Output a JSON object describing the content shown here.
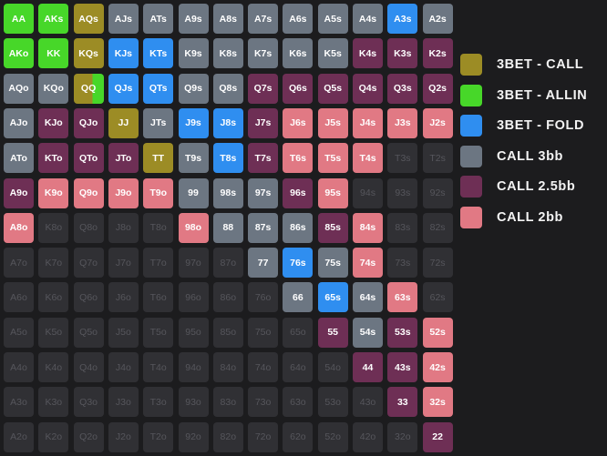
{
  "colors": {
    "3bet_call": "#9c8c25",
    "3bet_allin": "#47d729",
    "3bet_fold": "#2f8ef0",
    "call_3bb": "#6c7682",
    "call_2_5bb": "#6e2f55",
    "call_2bb": "#e17984",
    "fold": "#303034"
  },
  "legend": [
    {
      "key": "3bet_call",
      "label": "3BET - CALL"
    },
    {
      "key": "3bet_allin",
      "label": "3BET - ALLIN"
    },
    {
      "key": "3bet_fold",
      "label": "3BET - FOLD"
    },
    {
      "key": "call_3bb",
      "label": "CALL 3bb"
    },
    {
      "key": "call_2_5bb",
      "label": "CALL 2.5bb"
    },
    {
      "key": "call_2bb",
      "label": "CALL 2bb"
    }
  ],
  "grid": [
    [
      [
        "AA",
        "3bet_allin"
      ],
      [
        "AKs",
        "3bet_allin"
      ],
      [
        "AQs",
        "3bet_call"
      ],
      [
        "AJs",
        "call_3bb"
      ],
      [
        "ATs",
        "call_3bb"
      ],
      [
        "A9s",
        "call_3bb"
      ],
      [
        "A8s",
        "call_3bb"
      ],
      [
        "A7s",
        "call_3bb"
      ],
      [
        "A6s",
        "call_3bb"
      ],
      [
        "A5s",
        "call_3bb"
      ],
      [
        "A4s",
        "call_3bb"
      ],
      [
        "A3s",
        "3bet_fold"
      ],
      [
        "A2s",
        "call_3bb"
      ]
    ],
    [
      [
        "AKo",
        "3bet_allin"
      ],
      [
        "KK",
        "3bet_allin"
      ],
      [
        "KQs",
        "3bet_call"
      ],
      [
        "KJs",
        "3bet_fold"
      ],
      [
        "KTs",
        "3bet_fold"
      ],
      [
        "K9s",
        "call_3bb"
      ],
      [
        "K8s",
        "call_3bb"
      ],
      [
        "K7s",
        "call_3bb"
      ],
      [
        "K6s",
        "call_3bb"
      ],
      [
        "K5s",
        "call_3bb"
      ],
      [
        "K4s",
        "call_2_5bb"
      ],
      [
        "K3s",
        "call_2_5bb"
      ],
      [
        "K2s",
        "call_2_5bb"
      ]
    ],
    [
      [
        "AQo",
        "call_3bb"
      ],
      [
        "KQo",
        "call_3bb"
      ],
      [
        "QQ",
        "split_call_allin"
      ],
      [
        "QJs",
        "3bet_fold"
      ],
      [
        "QTs",
        "3bet_fold"
      ],
      [
        "Q9s",
        "call_3bb"
      ],
      [
        "Q8s",
        "call_3bb"
      ],
      [
        "Q7s",
        "call_2_5bb"
      ],
      [
        "Q6s",
        "call_2_5bb"
      ],
      [
        "Q5s",
        "call_2_5bb"
      ],
      [
        "Q4s",
        "call_2_5bb"
      ],
      [
        "Q3s",
        "call_2_5bb"
      ],
      [
        "Q2s",
        "call_2_5bb"
      ]
    ],
    [
      [
        "AJo",
        "call_3bb"
      ],
      [
        "KJo",
        "call_2_5bb"
      ],
      [
        "QJo",
        "call_2_5bb"
      ],
      [
        "JJ",
        "3bet_call"
      ],
      [
        "JTs",
        "call_3bb"
      ],
      [
        "J9s",
        "3bet_fold"
      ],
      [
        "J8s",
        "3bet_fold"
      ],
      [
        "J7s",
        "call_2_5bb"
      ],
      [
        "J6s",
        "call_2bb"
      ],
      [
        "J5s",
        "call_2bb"
      ],
      [
        "J4s",
        "call_2bb"
      ],
      [
        "J3s",
        "call_2bb"
      ],
      [
        "J2s",
        "call_2bb"
      ]
    ],
    [
      [
        "ATo",
        "call_3bb"
      ],
      [
        "KTo",
        "call_2_5bb"
      ],
      [
        "QTo",
        "call_2_5bb"
      ],
      [
        "JTo",
        "call_2_5bb"
      ],
      [
        "TT",
        "3bet_call"
      ],
      [
        "T9s",
        "call_3bb"
      ],
      [
        "T8s",
        "3bet_fold"
      ],
      [
        "T7s",
        "call_2_5bb"
      ],
      [
        "T6s",
        "call_2bb"
      ],
      [
        "T5s",
        "call_2bb"
      ],
      [
        "T4s",
        "call_2bb"
      ],
      [
        "T3s",
        "fold"
      ],
      [
        "T2s",
        "fold"
      ]
    ],
    [
      [
        "A9o",
        "call_2_5bb"
      ],
      [
        "K9o",
        "call_2bb"
      ],
      [
        "Q9o",
        "call_2bb"
      ],
      [
        "J9o",
        "call_2bb"
      ],
      [
        "T9o",
        "call_2bb"
      ],
      [
        "99",
        "call_3bb"
      ],
      [
        "98s",
        "call_3bb"
      ],
      [
        "97s",
        "call_3bb"
      ],
      [
        "96s",
        "call_2_5bb"
      ],
      [
        "95s",
        "call_2bb"
      ],
      [
        "94s",
        "fold"
      ],
      [
        "93s",
        "fold"
      ],
      [
        "92s",
        "fold"
      ]
    ],
    [
      [
        "A8o",
        "call_2bb"
      ],
      [
        "K8o",
        "fold"
      ],
      [
        "Q8o",
        "fold"
      ],
      [
        "J8o",
        "fold"
      ],
      [
        "T8o",
        "fold"
      ],
      [
        "98o",
        "call_2bb"
      ],
      [
        "88",
        "call_3bb"
      ],
      [
        "87s",
        "call_3bb"
      ],
      [
        "86s",
        "call_3bb"
      ],
      [
        "85s",
        "call_2_5bb"
      ],
      [
        "84s",
        "call_2bb"
      ],
      [
        "83s",
        "fold"
      ],
      [
        "82s",
        "fold"
      ]
    ],
    [
      [
        "A7o",
        "fold"
      ],
      [
        "K7o",
        "fold"
      ],
      [
        "Q7o",
        "fold"
      ],
      [
        "J7o",
        "fold"
      ],
      [
        "T7o",
        "fold"
      ],
      [
        "97o",
        "fold"
      ],
      [
        "87o",
        "fold"
      ],
      [
        "77",
        "call_3bb"
      ],
      [
        "76s",
        "3bet_fold"
      ],
      [
        "75s",
        "call_3bb"
      ],
      [
        "74s",
        "call_2bb"
      ],
      [
        "73s",
        "fold"
      ],
      [
        "72s",
        "fold"
      ]
    ],
    [
      [
        "A6o",
        "fold"
      ],
      [
        "K6o",
        "fold"
      ],
      [
        "Q6o",
        "fold"
      ],
      [
        "J6o",
        "fold"
      ],
      [
        "T6o",
        "fold"
      ],
      [
        "96o",
        "fold"
      ],
      [
        "86o",
        "fold"
      ],
      [
        "76o",
        "fold"
      ],
      [
        "66",
        "call_3bb"
      ],
      [
        "65s",
        "3bet_fold"
      ],
      [
        "64s",
        "call_3bb"
      ],
      [
        "63s",
        "call_2bb"
      ],
      [
        "62s",
        "fold"
      ]
    ],
    [
      [
        "A5o",
        "fold"
      ],
      [
        "K5o",
        "fold"
      ],
      [
        "Q5o",
        "fold"
      ],
      [
        "J5o",
        "fold"
      ],
      [
        "T5o",
        "fold"
      ],
      [
        "95o",
        "fold"
      ],
      [
        "85o",
        "fold"
      ],
      [
        "75o",
        "fold"
      ],
      [
        "65o",
        "fold"
      ],
      [
        "55",
        "call_2_5bb"
      ],
      [
        "54s",
        "call_3bb"
      ],
      [
        "53s",
        "call_2_5bb"
      ],
      [
        "52s",
        "call_2bb"
      ]
    ],
    [
      [
        "A4o",
        "fold"
      ],
      [
        "K4o",
        "fold"
      ],
      [
        "Q4o",
        "fold"
      ],
      [
        "J4o",
        "fold"
      ],
      [
        "T4o",
        "fold"
      ],
      [
        "94o",
        "fold"
      ],
      [
        "84o",
        "fold"
      ],
      [
        "74o",
        "fold"
      ],
      [
        "64o",
        "fold"
      ],
      [
        "54o",
        "fold"
      ],
      [
        "44",
        "call_2_5bb"
      ],
      [
        "43s",
        "call_2_5bb"
      ],
      [
        "42s",
        "call_2bb"
      ]
    ],
    [
      [
        "A3o",
        "fold"
      ],
      [
        "K3o",
        "fold"
      ],
      [
        "Q3o",
        "fold"
      ],
      [
        "J3o",
        "fold"
      ],
      [
        "T3o",
        "fold"
      ],
      [
        "93o",
        "fold"
      ],
      [
        "83o",
        "fold"
      ],
      [
        "73o",
        "fold"
      ],
      [
        "63o",
        "fold"
      ],
      [
        "53o",
        "fold"
      ],
      [
        "43o",
        "fold"
      ],
      [
        "33",
        "call_2_5bb"
      ],
      [
        "32s",
        "call_2bb"
      ]
    ],
    [
      [
        "A2o",
        "fold"
      ],
      [
        "K2o",
        "fold"
      ],
      [
        "Q2o",
        "fold"
      ],
      [
        "J2o",
        "fold"
      ],
      [
        "T2o",
        "fold"
      ],
      [
        "92o",
        "fold"
      ],
      [
        "82o",
        "fold"
      ],
      [
        "72o",
        "fold"
      ],
      [
        "62o",
        "fold"
      ],
      [
        "52o",
        "fold"
      ],
      [
        "42o",
        "fold"
      ],
      [
        "32o",
        "fold"
      ],
      [
        "22",
        "call_2_5bb"
      ]
    ]
  ]
}
